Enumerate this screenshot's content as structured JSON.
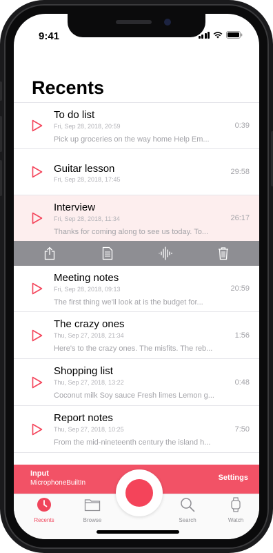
{
  "status_bar": {
    "time": "9:41"
  },
  "page": {
    "title": "Recents"
  },
  "recordings": [
    {
      "name": "To do list",
      "date": "Fri, Sep 28, 2018, 20:59",
      "duration": "0:39",
      "snippet": "Pick up groceries on the way home  Help Em..."
    },
    {
      "name": "Guitar lesson",
      "date": "Fri, Sep 28, 2018, 17:45",
      "duration": "29:58",
      "snippet": ""
    },
    {
      "name": "Interview",
      "date": "Fri, Sep 28, 2018, 11:34",
      "duration": "26:17",
      "snippet": "Thanks for coming along to see us today. To..."
    },
    {
      "name": "Meeting notes",
      "date": "Fri, Sep 28, 2018, 09:13",
      "duration": "20:59",
      "snippet": "The first thing we'll look at is the budget for..."
    },
    {
      "name": "The crazy ones",
      "date": "Thu, Sep 27, 2018, 21:34",
      "duration": "1:56",
      "snippet": "Here's to the crazy ones. The misfits. The reb..."
    },
    {
      "name": "Shopping list",
      "date": "Thu, Sep 27, 2018, 13:22",
      "duration": "0:48",
      "snippet": "Coconut milk Soy sauce Fresh limes Lemon g..."
    },
    {
      "name": "Report notes",
      "date": "Thu, Sep 27, 2018, 10:25",
      "duration": "7:50",
      "snippet": "From the mid-nineteenth century the island h..."
    }
  ],
  "selected_index": 2,
  "action_toolbar": {
    "icons": [
      "share-icon",
      "document-icon",
      "waveform-icon",
      "trash-icon"
    ]
  },
  "input_bar": {
    "label": "Input",
    "value": "MicrophoneBuiltIn",
    "settings_label": "Settings"
  },
  "tab_bar": {
    "tabs": [
      {
        "label": "Recents",
        "icon": "clock-icon",
        "active": true
      },
      {
        "label": "Browse",
        "icon": "folder-icon",
        "active": false
      },
      {
        "label": "Search",
        "icon": "search-icon",
        "active": false
      },
      {
        "label": "Watch",
        "icon": "watch-icon",
        "active": false
      }
    ]
  },
  "colors": {
    "accent": "#f4445a",
    "toolbar": "#8e8e93",
    "selected_row": "#fdeeee",
    "input_bar": "#f25266"
  }
}
